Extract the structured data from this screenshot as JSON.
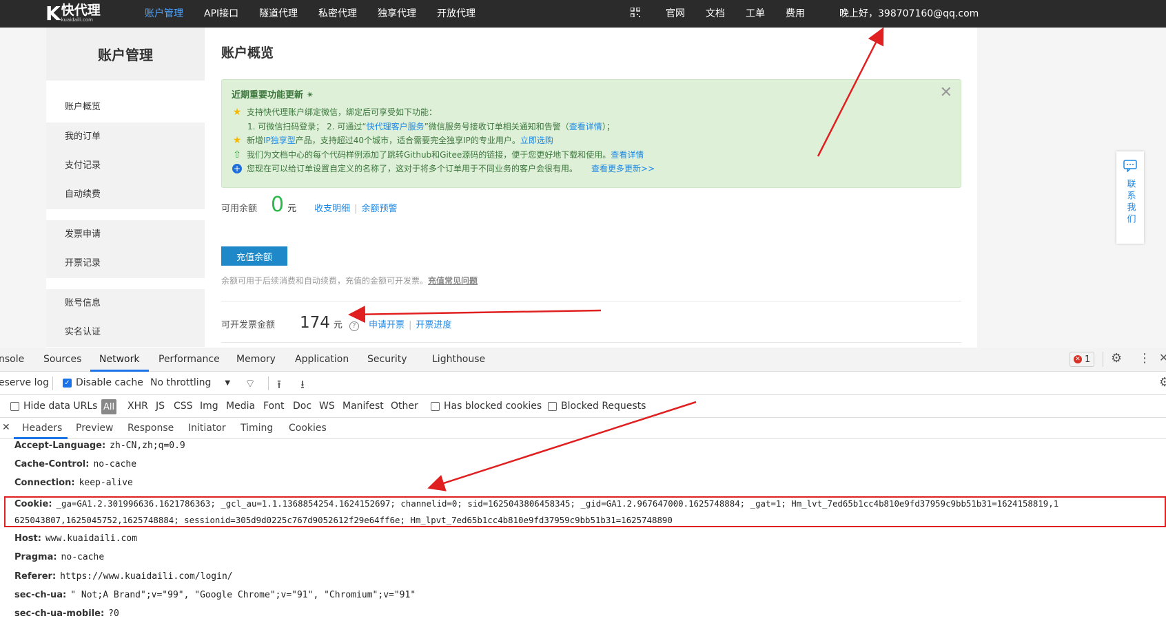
{
  "topbar": {
    "logo_mark": "K",
    "logo_name": "快代理",
    "logo_domain": "kuaidaili.com",
    "nav": [
      "账户管理",
      "API接口",
      "隧道代理",
      "私密代理",
      "独享代理",
      "开放代理"
    ],
    "right": [
      "官网",
      "文档",
      "工单",
      "费用"
    ],
    "greeting": "晚上好，398707160@qq.com"
  },
  "sidebar": {
    "title": "账户管理",
    "items": [
      "账户概览",
      "我的订单",
      "支付记录",
      "自动续费",
      "发票申请",
      "开票记录",
      "账号信息",
      "实名认证"
    ]
  },
  "main": {
    "title": "账户概览",
    "notice": {
      "title": "近期重要功能更新",
      "line1": "支持快代理账户绑定微信，绑定后可享受如下功能：",
      "line1_sub_a": "1. 可微信扫码登录；  2. 可通过“",
      "line1_sub_link": "快代理客户服务",
      "line1_sub_b": "”微信服务号接收订单相关通知和告警（",
      "line1_sub_link2": "查看详情",
      "line1_sub_c": "）；",
      "line2_a": "新增",
      "line2_link": "IP独享型",
      "line2_b": "产品，支持超过40个城市，适合需要完全独享IP的专业用户。",
      "line2_link2": "立即选购",
      "line3_a": "我们为文档中心的每个代码样例添加了跳转Github和Gitee源码的链接，便于您更好地下载和使用。",
      "line3_link": "查看详情",
      "line4_a": "您现在可以给订单设置自定义的名称了，这对于将多个订单用于不同业务的客户会很有用。",
      "line4_link": "查看更多更新>>"
    },
    "balance_label": "可用余额",
    "balance_value": "0",
    "unit": "元",
    "balance_link1": "收支明细",
    "balance_link2": "余额预警",
    "recharge_button": "充值余额",
    "hint_a": "余额可用于后续消费和自动续费，充值的金额可开发票。",
    "hint_link": "充值常见问题",
    "invoice_label": "可开发票金额",
    "invoice_value": "174",
    "invoice_link1": "申请开票",
    "invoice_link2": "开票进度"
  },
  "contact": {
    "label": "联系我们"
  },
  "devtools": {
    "tabs": [
      "nsole",
      "Sources",
      "Network",
      "Performance",
      "Memory",
      "Application",
      "Security",
      "Lighthouse"
    ],
    "active_tab": "Network",
    "error_count": "1",
    "toolbar": {
      "preserve_log": "eserve log",
      "disable_cache": "Disable cache",
      "throttling": "No throttling"
    },
    "filters": {
      "hide_data_urls": "Hide data URLs",
      "all": "All",
      "types": [
        "XHR",
        "JS",
        "CSS",
        "Img",
        "Media",
        "Font",
        "Doc",
        "WS",
        "Manifest",
        "Other"
      ],
      "has_blocked_cookies": "Has blocked cookies",
      "blocked_requests": "Blocked Requests"
    },
    "subtabs": [
      "Headers",
      "Preview",
      "Response",
      "Initiator",
      "Timing",
      "Cookies"
    ],
    "headers": [
      {
        "key": "Accept-Language:",
        "value": "zh-CN,zh;q=0.9"
      },
      {
        "key": "Cache-Control:",
        "value": "no-cache"
      },
      {
        "key": "Connection:",
        "value": "keep-alive"
      }
    ],
    "cookie_key": "Cookie:",
    "cookie_line1": "_ga=GA1.2.301996636.1621786363; _gcl_au=1.1.1368854254.1624152697; channelid=0; sid=1625043806458345; _gid=GA1.2.967647000.1625748884; _gat=1; Hm_lvt_7ed65b1cc4b810e9fd37959c9bb51b31=1624158819,1",
    "cookie_line2": "625043807,1625045752,1625748884; sessionid=305d9d0225c767d9052612f29e64ff6e; Hm_lpvt_7ed65b1cc4b810e9fd37959c9bb51b31=1625748890",
    "headers2": [
      {
        "key": "Host:",
        "value": "www.kuaidaili.com"
      },
      {
        "key": "Pragma:",
        "value": "no-cache"
      },
      {
        "key": "Referer:",
        "value": "https://www.kuaidaili.com/login/"
      },
      {
        "key": "sec-ch-ua:",
        "value": "\" Not;A Brand\";v=\"99\", \"Google Chrome\";v=\"91\", \"Chromium\";v=\"91\""
      },
      {
        "key": "sec-ch-ua-mobile:",
        "value": "?0"
      }
    ]
  },
  "colors": {
    "topbar": "#2b2b2b",
    "accent": "#1e88e5",
    "green": "#2db84d",
    "annotation": "#e02020"
  }
}
